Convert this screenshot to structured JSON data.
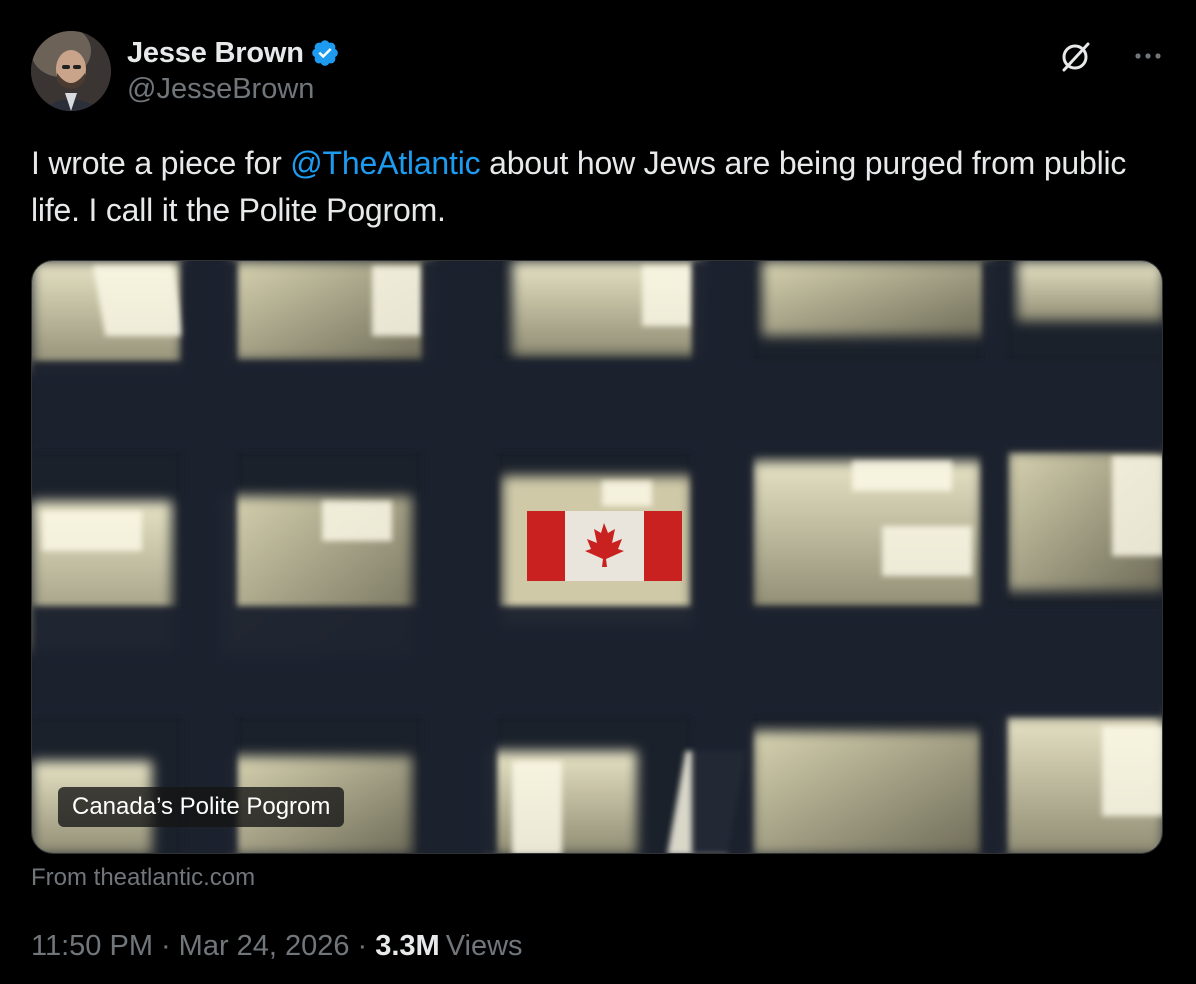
{
  "author": {
    "name": "Jesse Brown",
    "handle": "@JesseBrown",
    "verified": true,
    "avatar_icon": "avatar-photo"
  },
  "actions": {
    "grok_icon": "grok-icon",
    "more_icon": "more-options-icon"
  },
  "tweet": {
    "text_before": "I wrote a piece for ",
    "mention": "@TheAtlantic",
    "text_after": " about how Jews are being purged from public life. I call it the Polite Pogrom."
  },
  "card": {
    "title": "Canada’s Polite Pogrom",
    "source": "From theatlantic.com"
  },
  "meta": {
    "time": "11:50 PM",
    "separator": "·",
    "date": "Mar 24, 2026",
    "views_count": "3.3M",
    "views_label": "Views"
  },
  "colors": {
    "background": "#000000",
    "text": "#e7e9ea",
    "secondary": "#71767b",
    "link": "#1d9bf0",
    "verified": "#1d9bf0"
  }
}
